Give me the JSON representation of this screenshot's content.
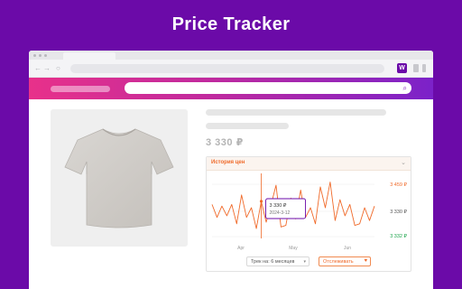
{
  "promo": {
    "title": "Price Tracker"
  },
  "browser": {
    "nav": {
      "back_icon": "arrow-left-icon",
      "forward_icon": "arrow-right-icon",
      "reload_icon": "reload-icon"
    },
    "extension": {
      "label": "W",
      "icon": "price-tracker-extension-icon"
    }
  },
  "site": {
    "search_icon": "search-icon"
  },
  "product": {
    "price": "3 330 ₽",
    "image": "tshirt-image"
  },
  "history": {
    "title": "История цен",
    "max_price": "3 459 ₽",
    "current_price": "3 330 ₽",
    "min_price": "3 332 ₽",
    "tooltip": {
      "price": "3 330 ₽",
      "date": "2024-3-12"
    },
    "period_label": "Трек на: 6 месяцев",
    "track_label": "Отслеживать",
    "colors": {
      "line": "#f06a2a",
      "max": "#f06a2a",
      "min": "#1aa34a",
      "accent": "#6b0aa8"
    }
  },
  "chart_data": {
    "type": "line",
    "x_tick_labels": [
      "Apr",
      "May",
      "Jun"
    ],
    "y_tick_labels": [
      "3 459 ₽",
      "3 330 ₽",
      "3 332 ₽"
    ],
    "grid": true,
    "series": [
      {
        "values": [
          3400,
          3360,
          3395,
          3365,
          3400,
          3340,
          3430,
          3360,
          3390,
          3325,
          3410,
          3345,
          3400,
          3460,
          3330,
          3335,
          3420,
          3355,
          3445,
          3360,
          3390,
          3340,
          3455,
          3390,
          3470,
          3350,
          3415,
          3365,
          3400,
          3335,
          3340,
          3390,
          3350,
          3395
        ]
      }
    ]
  }
}
